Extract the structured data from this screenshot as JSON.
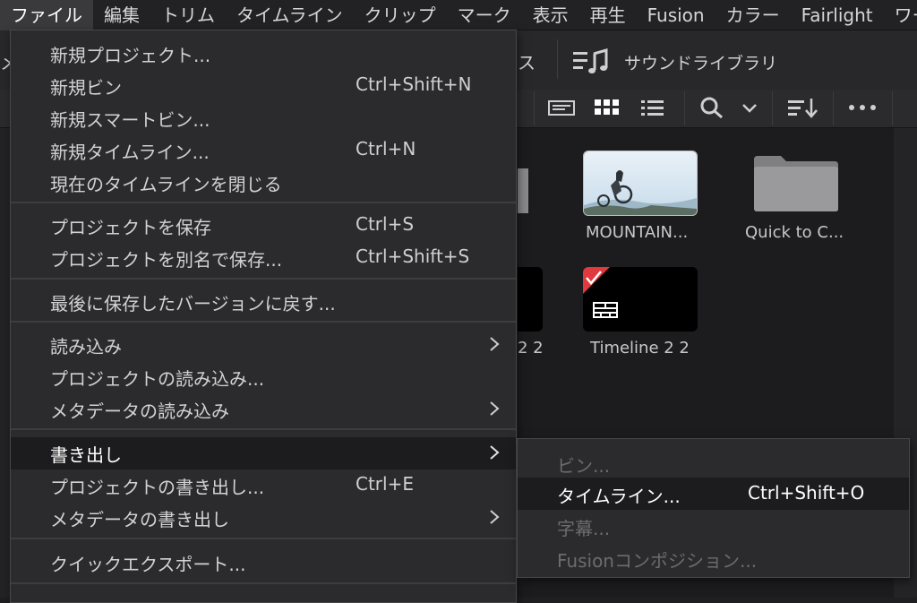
{
  "menubar": {
    "items": [
      "ファイル",
      "編集",
      "トリム",
      "タイムライン",
      "クリップ",
      "マーク",
      "表示",
      "再生",
      "Fusion",
      "カラー",
      "Fairlight",
      "ワー"
    ]
  },
  "toolbar": {
    "left_partial": "メ",
    "su_partial": "ス",
    "sound_library": "サウンドライブラリ"
  },
  "pool": {
    "partial_clip_label": "2 2",
    "clips": [
      {
        "label": "MOUNTAIN..."
      },
      {
        "label": "Quick to C..."
      },
      {
        "label": "Timeline 2 2"
      }
    ]
  },
  "file_menu": {
    "items": [
      {
        "label": "新規プロジェクト...",
        "shortcut": ""
      },
      {
        "label": "新規ビン",
        "shortcut": "Ctrl+Shift+N"
      },
      {
        "label": "新規スマートビン...",
        "shortcut": ""
      },
      {
        "label": "新規タイムライン...",
        "shortcut": "Ctrl+N"
      },
      {
        "label": "現在のタイムラインを閉じる",
        "shortcut": ""
      },
      {
        "label": "プロジェクトを保存",
        "shortcut": "Ctrl+S"
      },
      {
        "label": "プロジェクトを別名で保存...",
        "shortcut": "Ctrl+Shift+S"
      },
      {
        "label": "最後に保存したバージョンに戻す...",
        "shortcut": ""
      },
      {
        "label": "読み込み",
        "shortcut": ""
      },
      {
        "label": "プロジェクトの読み込み...",
        "shortcut": ""
      },
      {
        "label": "メタデータの読み込み",
        "shortcut": ""
      },
      {
        "label": "書き出し",
        "shortcut": ""
      },
      {
        "label": "プロジェクトの書き出し...",
        "shortcut": "Ctrl+E"
      },
      {
        "label": "メタデータの書き出し",
        "shortcut": ""
      },
      {
        "label": "クイックエクスポート...",
        "shortcut": ""
      }
    ]
  },
  "export_submenu": {
    "items": [
      {
        "label": "ビン...",
        "shortcut": ""
      },
      {
        "label": "タイムライン...",
        "shortcut": "Ctrl+Shift+O"
      },
      {
        "label": "字幕...",
        "shortcut": ""
      },
      {
        "label": "Fusionコンポジション...",
        "shortcut": ""
      }
    ]
  },
  "colors": {
    "accent_red": "#e0393e",
    "menu_bg": "#2b2b2d",
    "highlight_bg": "#1c1c1e"
  }
}
